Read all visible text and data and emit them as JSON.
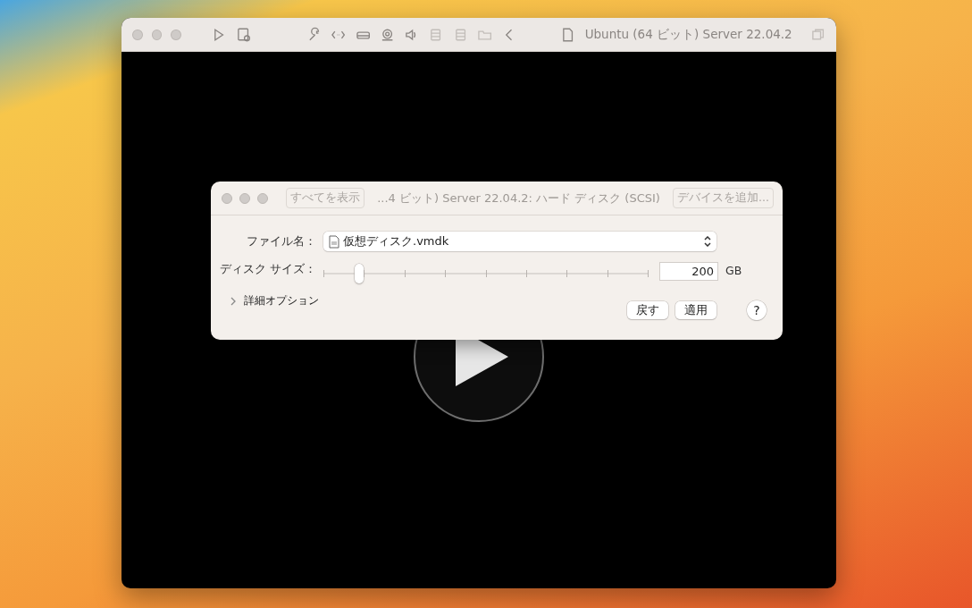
{
  "window": {
    "title": "Ubuntu (64 ビット) Server 22.04.2"
  },
  "dialog": {
    "title": "...4 ビット) Server 22.04.2: ハード ディスク (SCSI)",
    "show_all_button": "すべてを表示",
    "add_device_button": "デバイスを追加...",
    "file_label": "ファイル名：",
    "file_value": "仮想ディスク.vmdk",
    "size_label": "ディスク サイズ：",
    "size_slider": {
      "level": 0.11
    },
    "size_value": "200",
    "size_unit": "GB",
    "advanced": {
      "label": "詳細オプション",
      "expanded": false
    },
    "buttons": [
      "戻す",
      "適用"
    ],
    "help_button": "?"
  }
}
